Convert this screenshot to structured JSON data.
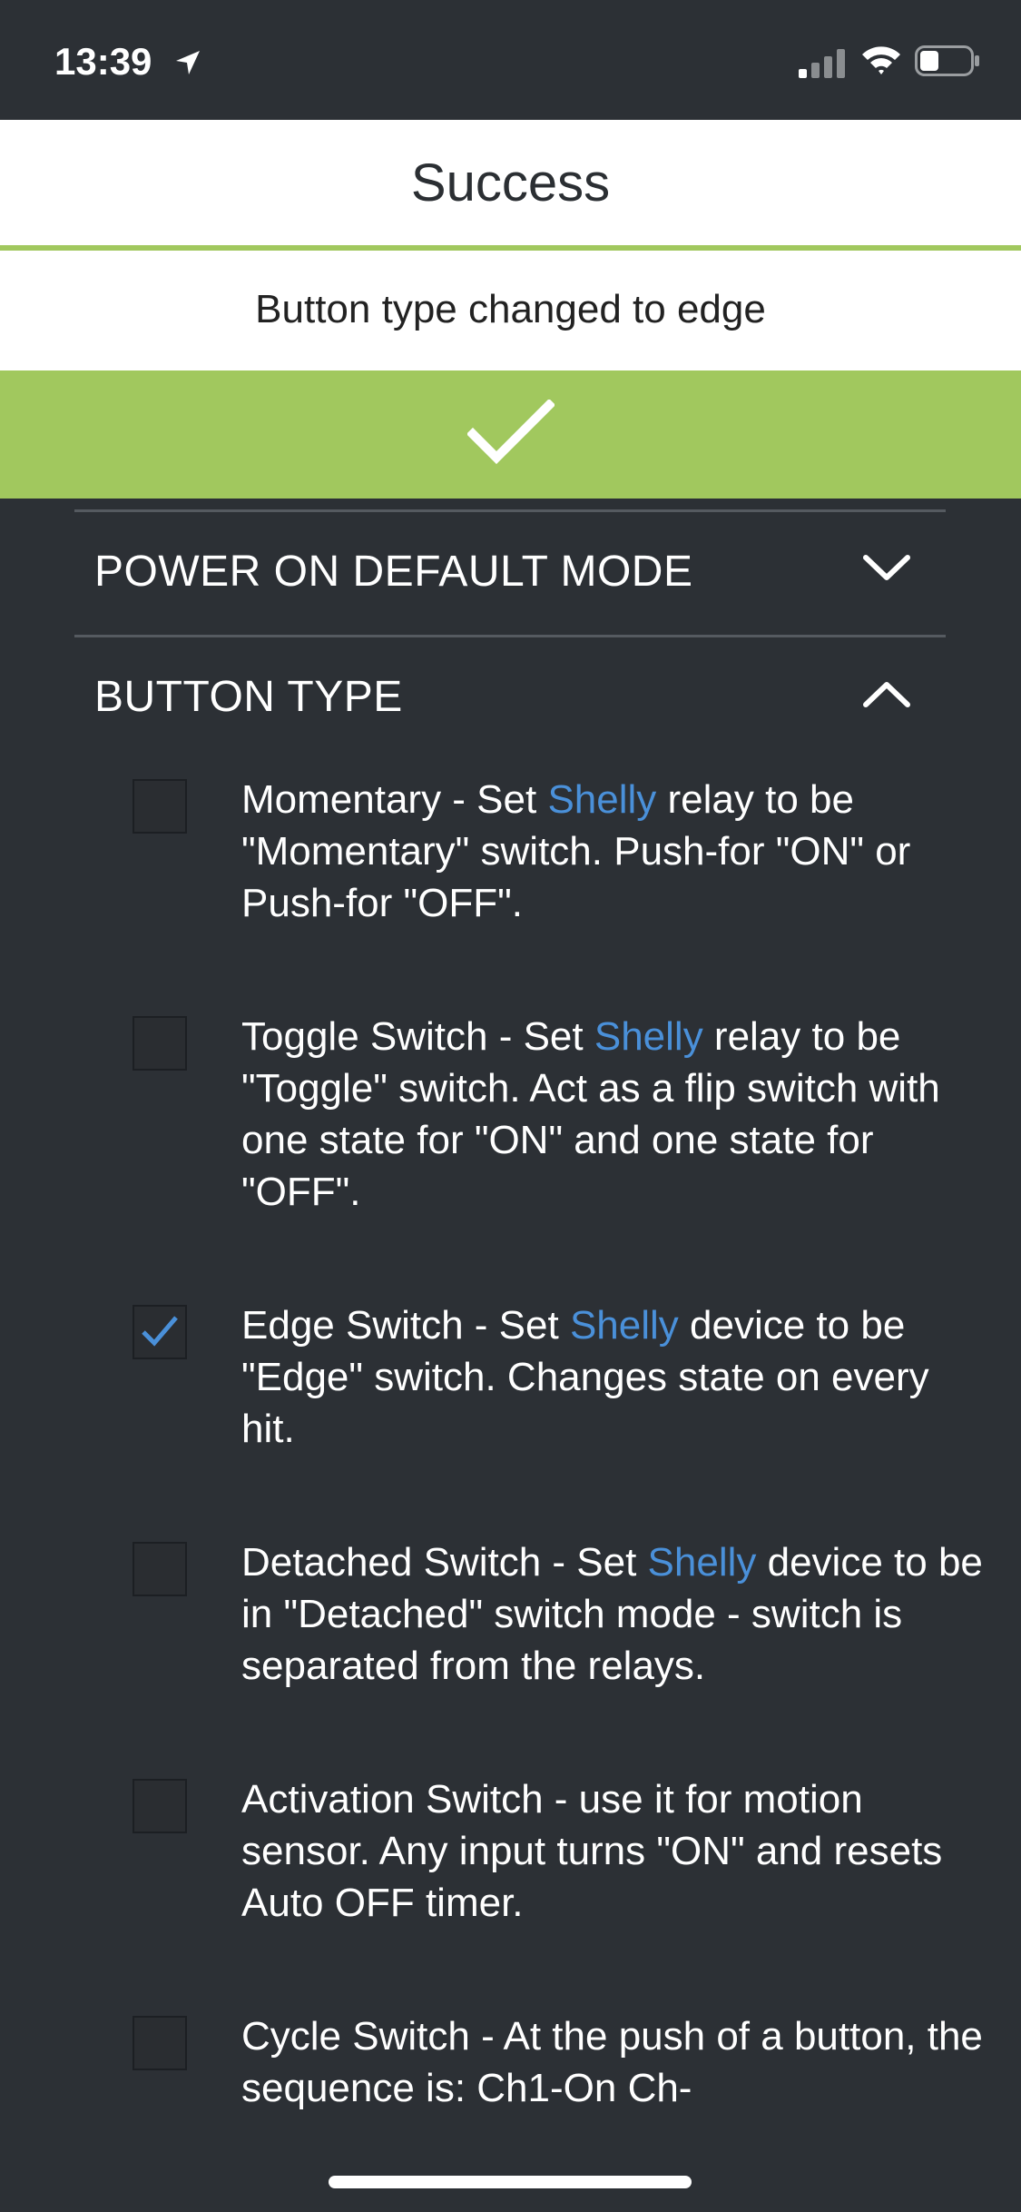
{
  "status_bar": {
    "time": "13:39",
    "icons": [
      "location-arrow-icon",
      "cellular-signal-icon",
      "wifi-icon",
      "battery-icon"
    ]
  },
  "toast": {
    "title": "Success",
    "message": "Button type changed to edge",
    "confirm_icon": "checkmark-icon"
  },
  "sections": [
    {
      "title": "POWER ON DEFAULT MODE",
      "expanded": false,
      "chevron": "chevron-down-icon"
    },
    {
      "title": "BUTTON TYPE",
      "expanded": true,
      "chevron": "chevron-up-icon"
    }
  ],
  "button_type_options": [
    {
      "checked": false,
      "before": "Momentary - Set ",
      "brand": "Shelly",
      "after": " relay to be \"Momentary\" switch. Push-for \"ON\" or Push-for \"OFF\"."
    },
    {
      "checked": false,
      "before": "Toggle Switch - Set ",
      "brand": "Shelly",
      "after": " relay to be \"Toggle\" switch. Act as a flip switch with one state for \"ON\" and one state for \"OFF\"."
    },
    {
      "checked": true,
      "before": "Edge Switch - Set ",
      "brand": "Shelly",
      "after": " device to be \"Edge\" switch. Changes state on every hit."
    },
    {
      "checked": false,
      "before": "Detached Switch - Set ",
      "brand": "Shelly",
      "after": " device to be in \"Detached\" switch mode - switch is separated from the relays."
    },
    {
      "checked": false,
      "before": "Activation Switch - use it for motion sensor. Any input turns \"ON\" and resets Auto OFF timer.",
      "brand": "",
      "after": ""
    },
    {
      "checked": false,
      "before": "Cycle Switch - At the push of a button, the sequence is: Ch1-On Ch-",
      "brand": "",
      "after": ""
    }
  ],
  "colors": {
    "background": "#2c3035",
    "accent_green": "#a1c85e",
    "brand_blue": "#4a90d9",
    "toast_background": "#ffffff"
  }
}
